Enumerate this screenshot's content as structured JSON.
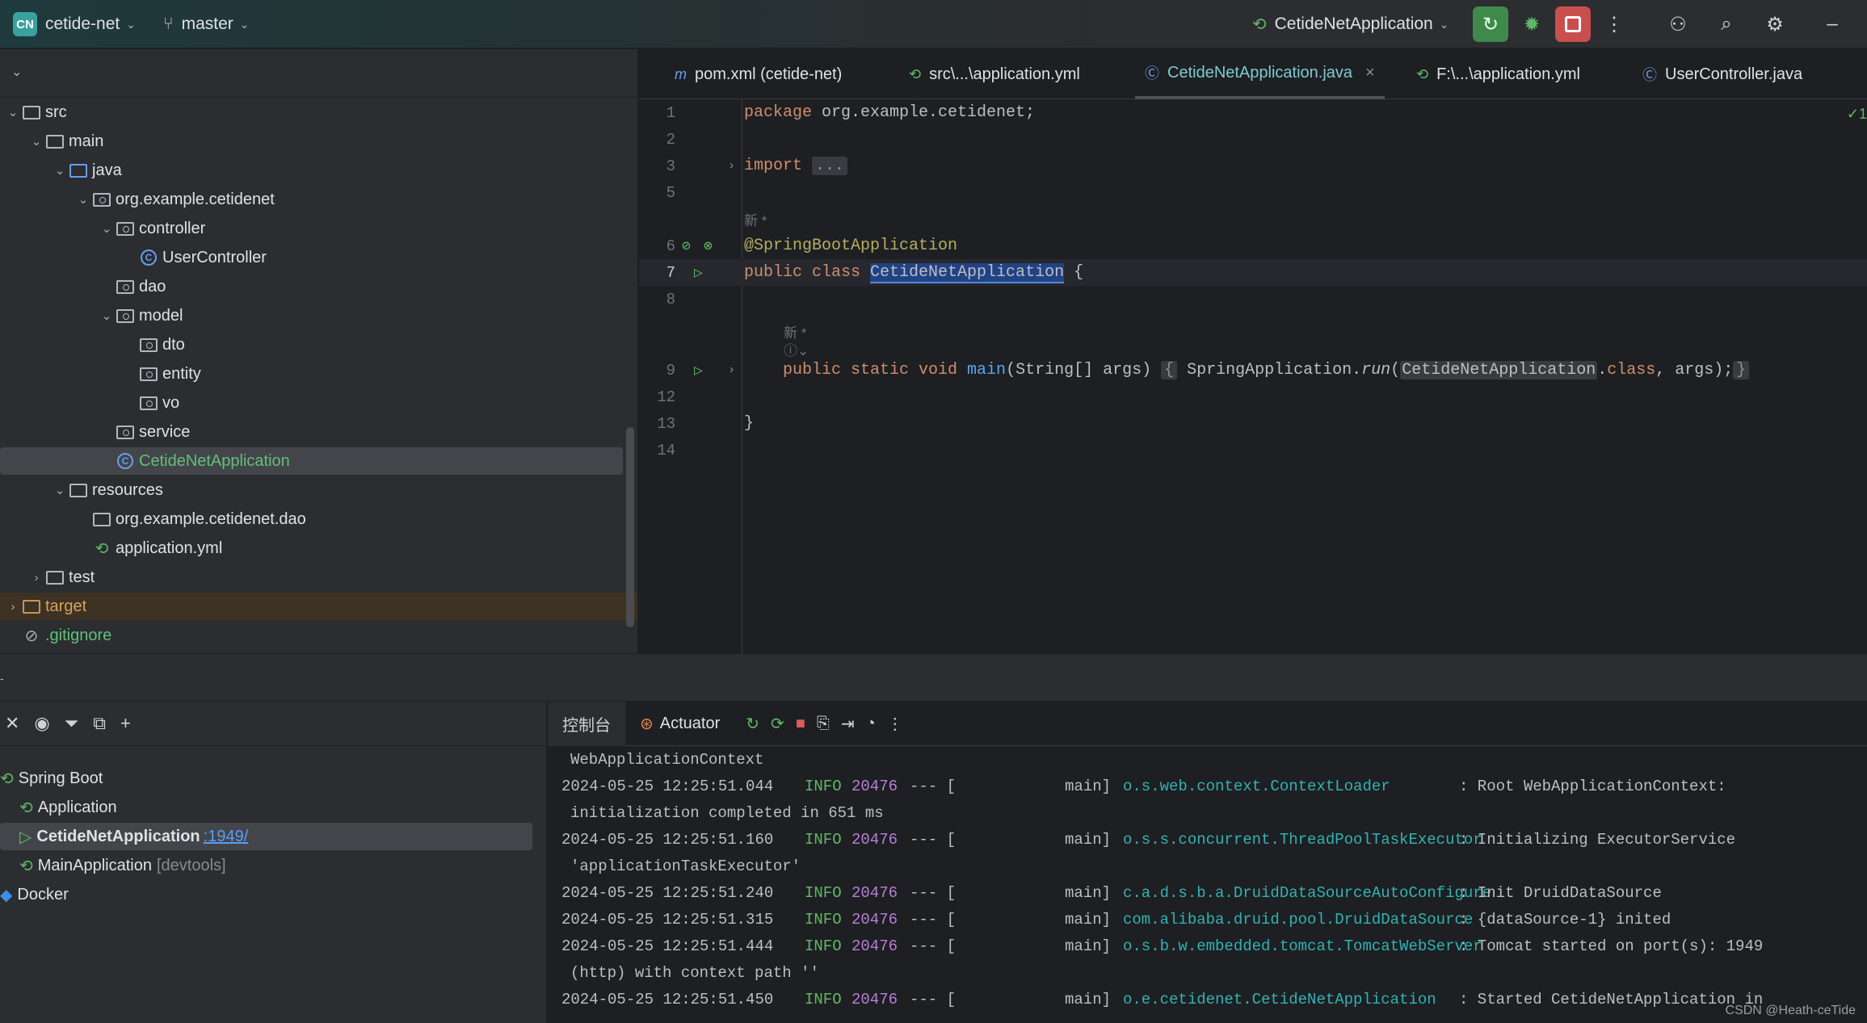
{
  "topbar": {
    "project_badge": "CN",
    "project_name": "cetide-net",
    "branch": "master",
    "run_config": "CetideNetApplication",
    "icons": [
      "git-branch-icon",
      "spring-run-icon",
      "rerun-icon",
      "debug-icon",
      "stop-icon",
      "more-icon",
      "add-user-icon",
      "search-icon",
      "settings-icon",
      "minimize-icon"
    ]
  },
  "project_tree": [
    {
      "label": "src",
      "arrow": "⌄",
      "icon": "folder",
      "indent": 0
    },
    {
      "label": "main",
      "arrow": "⌄",
      "icon": "folder",
      "indent": 1
    },
    {
      "label": "java",
      "arrow": "⌄",
      "icon": "folder-blue",
      "indent": 2
    },
    {
      "label": "org.example.cetidenet",
      "arrow": "⌄",
      "icon": "package",
      "indent": 3
    },
    {
      "label": "controller",
      "arrow": "⌄",
      "icon": "package",
      "indent": 4
    },
    {
      "label": "UserController",
      "arrow": "",
      "icon": "class",
      "indent": 5
    },
    {
      "label": "dao",
      "arrow": "",
      "icon": "package",
      "indent": 4
    },
    {
      "label": "model",
      "arrow": "⌄",
      "icon": "package",
      "indent": 4
    },
    {
      "label": "dto",
      "arrow": "",
      "icon": "package",
      "indent": 5
    },
    {
      "label": "entity",
      "arrow": "",
      "icon": "package",
      "indent": 5
    },
    {
      "label": "vo",
      "arrow": "",
      "icon": "package",
      "indent": 5
    },
    {
      "label": "service",
      "arrow": "",
      "icon": "package",
      "indent": 4
    },
    {
      "label": "CetideNetApplication",
      "arrow": "",
      "icon": "spring-class",
      "indent": 4,
      "selected": true
    },
    {
      "label": "resources",
      "arrow": "⌄",
      "icon": "folder-res",
      "indent": 2
    },
    {
      "label": "org.example.cetidenet.dao",
      "arrow": "",
      "icon": "folder",
      "indent": 3
    },
    {
      "label": "application.yml",
      "arrow": "",
      "icon": "yml",
      "indent": 3
    },
    {
      "label": "test",
      "arrow": "›",
      "icon": "folder",
      "indent": 1
    },
    {
      "label": "target",
      "arrow": "›",
      "icon": "folder-orange",
      "indent": 0,
      "target": true
    },
    {
      "label": ".gitignore",
      "arrow": "",
      "icon": "ignore",
      "indent": 0,
      "gitignore": true
    }
  ],
  "tabs": [
    {
      "label": "pom.xml (cetide-net)",
      "icon": "m",
      "active": false
    },
    {
      "label": "src\\...\\application.yml",
      "icon": "yml",
      "active": false
    },
    {
      "label": "CetideNetApplication.java",
      "icon": "class",
      "active": true,
      "close": "×"
    },
    {
      "label": "F:\\...\\application.yml",
      "icon": "yml",
      "active": false
    },
    {
      "label": "UserController.java",
      "icon": "class",
      "active": false
    }
  ],
  "editor": {
    "check_mark": "✓1",
    "lines": {
      "l1": "1",
      "l2": "2",
      "l3": "3",
      "l5": "5",
      "l6": "6",
      "l7": "7",
      "l8": "8",
      "l9": "9",
      "l12": "12",
      "l13": "13",
      "l14": "14"
    },
    "package_kw": "package",
    "package_name": " org.example.cetidenet;",
    "import_kw": "import",
    "import_fold": "...",
    "hint_new": "新 *",
    "annotation": "@SpringBootApplication",
    "class_kw": "public class ",
    "class_name": "CetideNetApplication",
    "class_brace": " {",
    "hint_new2": "新 *",
    "hint_icon": "ⓘ⌄",
    "main_kw": "public static void ",
    "main_fn": "main",
    "main_args": "(String[] args) ",
    "fold_open": "{",
    "main_body_a": " SpringApplication.",
    "main_run": "run",
    "main_body_b": "(",
    "main_cls": "CetideNetApplication",
    "main_dot": ".",
    "main_class_kw": "class",
    "main_body_c": ", args);",
    "fold_close": "}",
    "close_brace": "}"
  },
  "services": {
    "items": [
      {
        "label": "Spring Boot",
        "indent": 0,
        "icon": "spring"
      },
      {
        "label": "Application",
        "indent": 1,
        "icon": "spring"
      },
      {
        "label": "CetideNetApplication",
        "indent": 1,
        "icon": "run",
        "port": ":1949/",
        "selected": true
      },
      {
        "label": "MainApplication",
        "indent": 1,
        "icon": "spring",
        "extra": "[devtools]"
      },
      {
        "label": "Docker",
        "indent": 0,
        "icon": "docker"
      }
    ]
  },
  "console": {
    "tab_console": "控制台",
    "tab_actuator": "Actuator",
    "logs": [
      {
        "cont": "WebApplicationContext"
      },
      {
        "ts": "2024-05-25 12:25:51.044",
        "lv": "INFO",
        "pid": "20476",
        "dash": "--- [",
        "th": "main]",
        "cls": "o.s.web.context.ContextLoader",
        "msg": ": Root WebApplicationContext:"
      },
      {
        "cont": "initialization completed in 651 ms"
      },
      {
        "ts": "2024-05-25 12:25:51.160",
        "lv": "INFO",
        "pid": "20476",
        "dash": "--- [",
        "th": "main]",
        "cls": "o.s.s.concurrent.ThreadPoolTaskExecutor",
        "msg": ": Initializing ExecutorService"
      },
      {
        "cont": "'applicationTaskExecutor'"
      },
      {
        "ts": "2024-05-25 12:25:51.240",
        "lv": "INFO",
        "pid": "20476",
        "dash": "--- [",
        "th": "main]",
        "cls": "c.a.d.s.b.a.DruidDataSourceAutoConfigure",
        "msg": ": Init DruidDataSource"
      },
      {
        "ts": "2024-05-25 12:25:51.315",
        "lv": "INFO",
        "pid": "20476",
        "dash": "--- [",
        "th": "main]",
        "cls": "com.alibaba.druid.pool.DruidDataSource",
        "msg": ": {dataSource-1} inited"
      },
      {
        "ts": "2024-05-25 12:25:51.444",
        "lv": "INFO",
        "pid": "20476",
        "dash": "--- [",
        "th": "main]",
        "cls": "o.s.b.w.embedded.tomcat.TomcatWebServer",
        "msg": ": Tomcat started on port(s): 1949"
      },
      {
        "cont": "(http) with context path ''"
      },
      {
        "ts": "2024-05-25 12:25:51.450",
        "lv": "INFO",
        "pid": "20476",
        "dash": "--- [",
        "th": "main]",
        "cls": "o.e.cetidenet.CetideNetApplication",
        "msg": ": Started CetideNetApplication in"
      }
    ]
  },
  "watermark": "CSDN @Heath-ceTide"
}
